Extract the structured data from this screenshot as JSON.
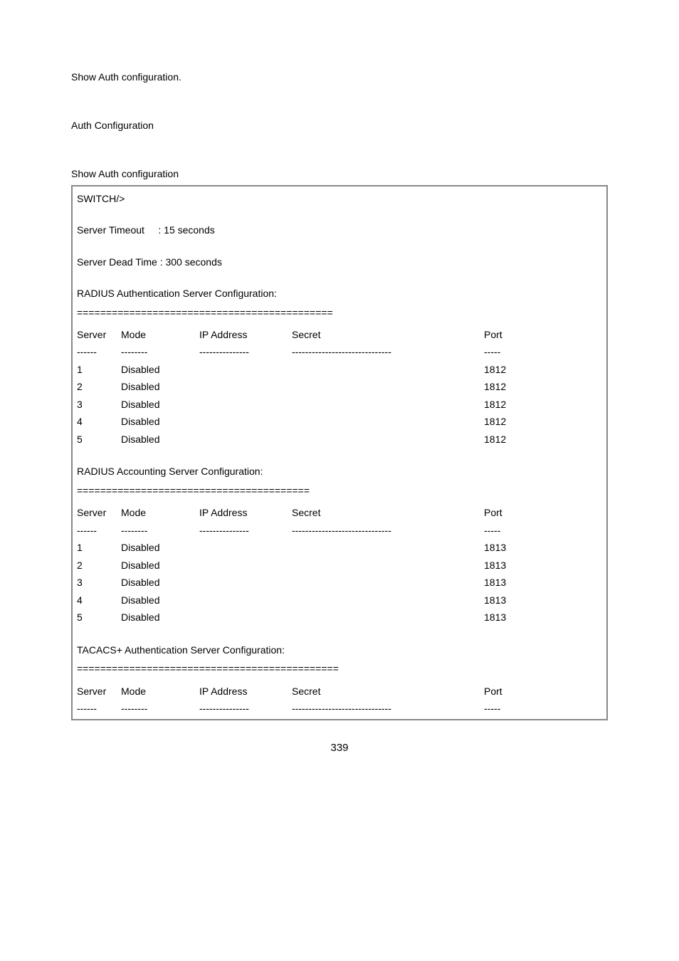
{
  "intro": "Show Auth configuration.",
  "sectionTitle": "Auth Configuration",
  "subtitle": "Show Auth configuration",
  "prompt": "SWITCH/>",
  "serverTimeout": "Server Timeout     : 15 seconds",
  "serverDeadTime": "Server Dead Time : 300 seconds",
  "radiusAuth": {
    "title": "RADIUS Authentication Server Configuration:",
    "divider": "============================================",
    "headers": {
      "server": "Server",
      "mode": "Mode",
      "ip": "IP Address",
      "secret": "Secret",
      "port": "Port"
    },
    "dashes": {
      "server": "------",
      "mode": "--------",
      "ip": "---------------",
      "secret": "------------------------------",
      "port": "-----"
    },
    "rows": [
      {
        "server": "1",
        "mode": "Disabled",
        "ip": "",
        "secret": "",
        "port": "1812"
      },
      {
        "server": "2",
        "mode": "Disabled",
        "ip": "",
        "secret": "",
        "port": "1812"
      },
      {
        "server": "3",
        "mode": "Disabled",
        "ip": "",
        "secret": "",
        "port": "1812"
      },
      {
        "server": "4",
        "mode": "Disabled",
        "ip": "",
        "secret": "",
        "port": "1812"
      },
      {
        "server": "5",
        "mode": "Disabled",
        "ip": "",
        "secret": "",
        "port": "1812"
      }
    ]
  },
  "radiusAcct": {
    "title": "RADIUS Accounting Server Configuration:",
    "divider": "========================================",
    "headers": {
      "server": "Server",
      "mode": "Mode",
      "ip": "IP Address",
      "secret": "Secret",
      "port": "Port"
    },
    "dashes": {
      "server": "------",
      "mode": "--------",
      "ip": "---------------",
      "secret": "------------------------------",
      "port": "-----"
    },
    "rows": [
      {
        "server": "1",
        "mode": "Disabled",
        "ip": "",
        "secret": "",
        "port": "1813"
      },
      {
        "server": "2",
        "mode": "Disabled",
        "ip": "",
        "secret": "",
        "port": "1813"
      },
      {
        "server": "3",
        "mode": "Disabled",
        "ip": "",
        "secret": "",
        "port": "1813"
      },
      {
        "server": "4",
        "mode": "Disabled",
        "ip": "",
        "secret": "",
        "port": "1813"
      },
      {
        "server": "5",
        "mode": "Disabled",
        "ip": "",
        "secret": "",
        "port": "1813"
      }
    ]
  },
  "tacacs": {
    "title": "TACACS+ Authentication Server Configuration:",
    "divider": "=============================================",
    "headers": {
      "server": "Server",
      "mode": "Mode",
      "ip": "IP Address",
      "secret": "Secret",
      "port": "Port"
    },
    "dashes": {
      "server": "------",
      "mode": "--------",
      "ip": "---------------",
      "secret": "------------------------------",
      "port": "-----"
    }
  },
  "pageNumber": "339"
}
